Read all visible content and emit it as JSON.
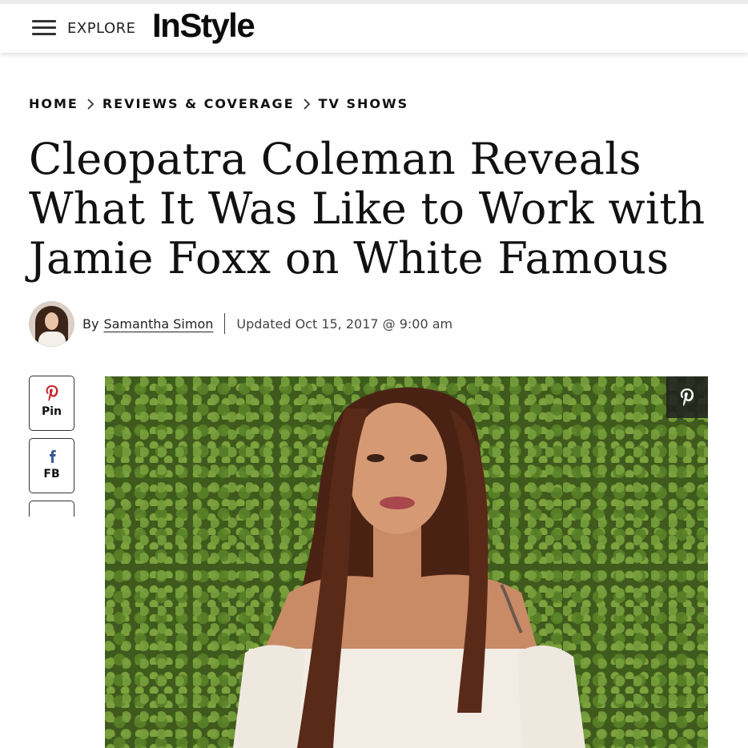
{
  "header": {
    "explore_label": "EXPLORE",
    "logo_text": "InStyle"
  },
  "breadcrumb": {
    "items": [
      "HOME",
      "REVIEWS & COVERAGE",
      "TV SHOWS"
    ]
  },
  "article": {
    "headline_lines": [
      "Cleopatra Coleman Reveals",
      "What It Was Like to Work with",
      "Jamie Foxx on White Famous"
    ],
    "by_label": "By",
    "author": "Samantha Simon",
    "updated": "Updated Oct 15, 2017 @ 9:00 am"
  },
  "share": {
    "pin_label": "Pin",
    "fb_label": "FB",
    "pin_icon": "pinterest-icon",
    "fb_icon": "facebook-icon"
  },
  "colors": {
    "pinterest": "#c8232c",
    "facebook": "#3b5998",
    "text": "#111111"
  }
}
